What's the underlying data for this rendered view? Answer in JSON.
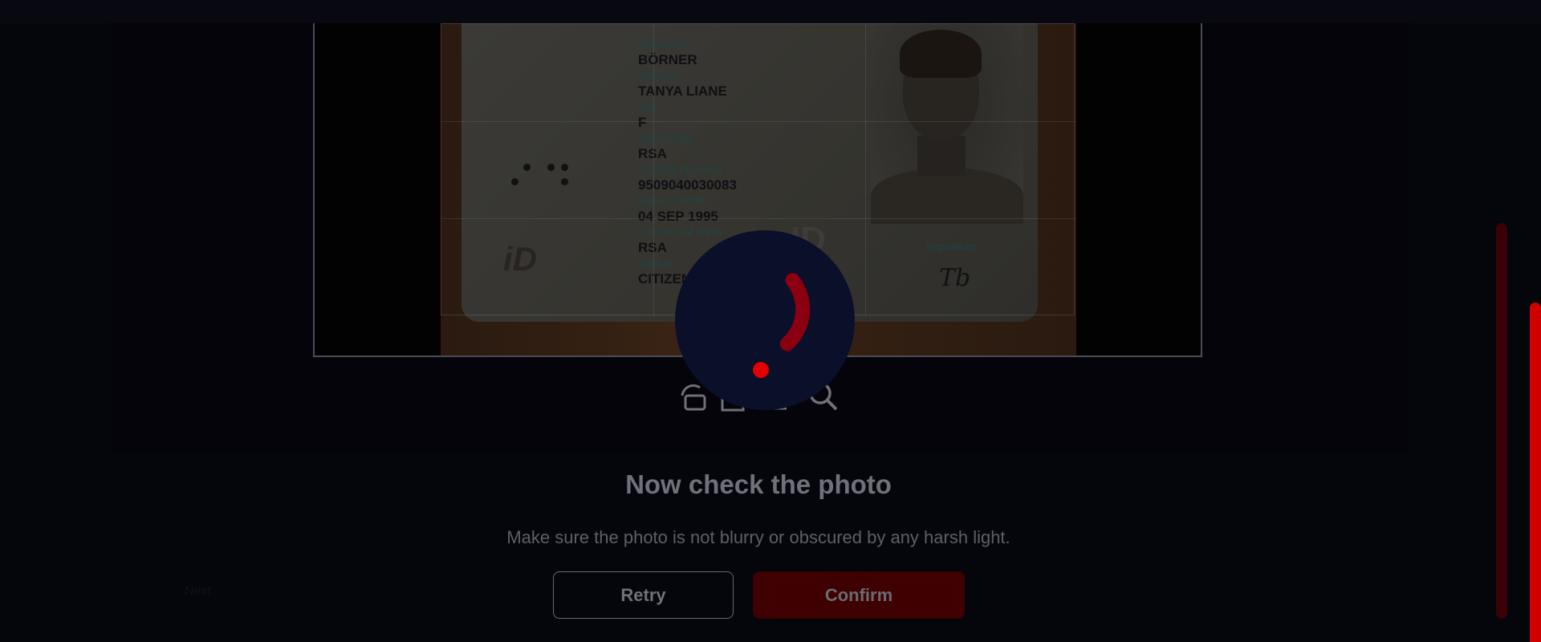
{
  "id_card": {
    "fields": [
      {
        "label": "Surname",
        "value": "BÖRNER"
      },
      {
        "label": "Names",
        "value": "TANYA LIANE"
      },
      {
        "label": "Sex",
        "value": "F"
      },
      {
        "label": "Nationality",
        "value": "RSA"
      },
      {
        "label": "Identity Number",
        "value": "9509040030083"
      },
      {
        "label": "Date of Birth",
        "value": "04 SEP 1995"
      },
      {
        "label": "Country of Birth",
        "value": "RSA"
      },
      {
        "label": "Status",
        "value": "CITIZEN"
      }
    ],
    "logo_text": "iD",
    "ghost_text": "ID",
    "signature_label": "Signature",
    "signature_mark": "Tb"
  },
  "toolbar": {
    "icons": [
      "rotate-icon",
      "crop-icon",
      "flip-icon",
      "zoom-icon"
    ]
  },
  "content": {
    "title": "Now check the photo",
    "subtitle": "Make sure the photo is not blurry or obscured by any harsh light.",
    "retry_label": "Retry",
    "confirm_label": "Confirm",
    "faint_label": "Next"
  },
  "colors": {
    "accent": "#d00000",
    "spinner_bg": "#0a0f2a",
    "spinner_arc": "#8a0010",
    "spinner_dot": "#e00000"
  },
  "loading": {
    "spinner_progress": 0.25
  }
}
